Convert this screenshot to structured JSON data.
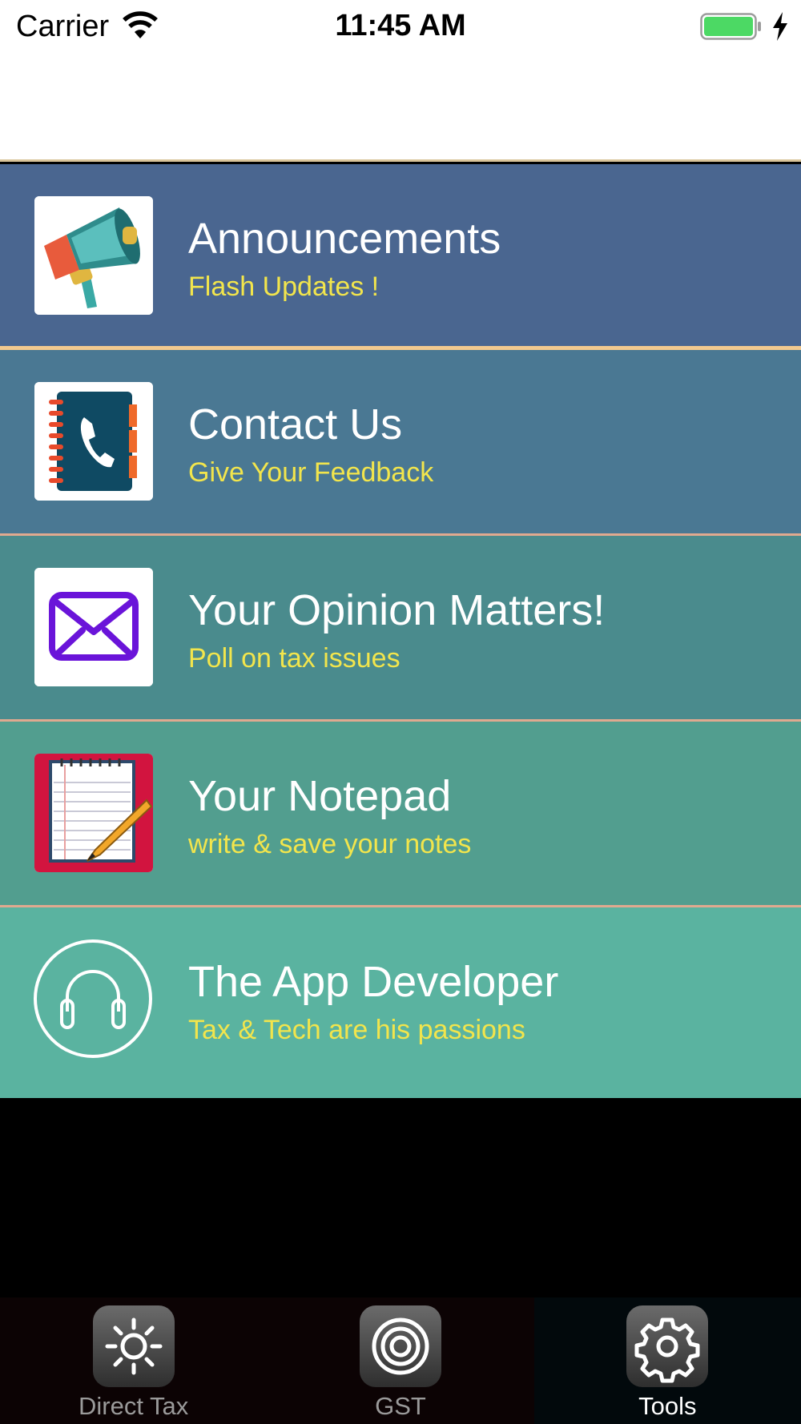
{
  "status_bar": {
    "carrier": "Carrier",
    "time": "11:45 AM",
    "battery_color": "#4cd964"
  },
  "menu": {
    "items": [
      {
        "title": "Announcements",
        "subtitle": "Flash Updates !",
        "icon": "megaphone-icon",
        "bg": "#4a6690"
      },
      {
        "title": "Contact Us",
        "subtitle": "Give Your Feedback",
        "icon": "phone-book-icon",
        "bg": "#4a7893"
      },
      {
        "title": "Your Opinion Matters!",
        "subtitle": "Poll on tax issues",
        "icon": "envelope-icon",
        "bg": "#4a8b8d"
      },
      {
        "title": "Your Notepad",
        "subtitle": "write & save your notes",
        "icon": "notepad-icon",
        "bg": "#529e8f"
      },
      {
        "title": "The App Developer",
        "subtitle": "Tax & Tech are his passions",
        "icon": "headphones-icon",
        "bg": "#5ab3a0"
      }
    ]
  },
  "tab_bar": {
    "tabs": [
      {
        "label": "Direct Tax",
        "icon": "sun-icon",
        "active": false
      },
      {
        "label": "GST",
        "icon": "target-icon",
        "active": false
      },
      {
        "label": "Tools",
        "icon": "gear-icon",
        "active": true
      }
    ]
  }
}
